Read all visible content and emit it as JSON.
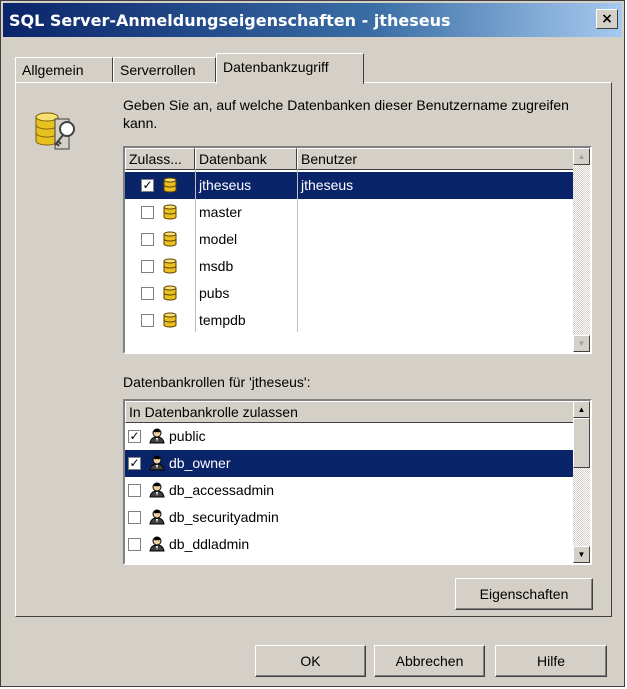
{
  "window": {
    "title": "SQL Server-Anmeldungseigenschaften - jtheseus",
    "close_label": "×"
  },
  "tabs": [
    {
      "label": "Allgemein",
      "active": false
    },
    {
      "label": "Serverrollen",
      "active": false
    },
    {
      "label": "Datenbankzugriff",
      "active": true
    }
  ],
  "description": "Geben Sie an, auf welche Datenbanken dieser Benutzername zugreifen kann.",
  "db_table": {
    "columns": [
      "Zulass...",
      "Datenbank",
      "Benutzer"
    ],
    "rows": [
      {
        "checked": true,
        "database": "jtheseus",
        "user": "jtheseus",
        "selected": true
      },
      {
        "checked": false,
        "database": "master",
        "user": "",
        "selected": false
      },
      {
        "checked": false,
        "database": "model",
        "user": "",
        "selected": false
      },
      {
        "checked": false,
        "database": "msdb",
        "user": "",
        "selected": false
      },
      {
        "checked": false,
        "database": "pubs",
        "user": "",
        "selected": false
      },
      {
        "checked": false,
        "database": "tempdb",
        "user": "",
        "selected": false
      }
    ]
  },
  "roles_label": "Datenbankrollen für 'jtheseus':",
  "roles_table": {
    "column": "In Datenbankrolle zulassen",
    "rows": [
      {
        "checked": true,
        "name": "public",
        "selected": false
      },
      {
        "checked": true,
        "name": "db_owner",
        "selected": true
      },
      {
        "checked": false,
        "name": "db_accessadmin",
        "selected": false
      },
      {
        "checked": false,
        "name": "db_securityadmin",
        "selected": false
      },
      {
        "checked": false,
        "name": "db_ddladmin",
        "selected": false
      }
    ]
  },
  "buttons": {
    "properties": "Eigenschaften",
    "ok": "OK",
    "cancel": "Abbrechen",
    "help": "Hilfe"
  },
  "check_glyph": "✓",
  "colors": {
    "selection": "#0a246a",
    "dialog": "#d4d0c8",
    "db_icon": "#e8c020"
  }
}
